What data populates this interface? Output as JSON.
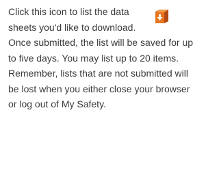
{
  "panel": {
    "icon": "download-list-icon",
    "text": "Click this icon to list the data sheets you'd like to download. Once submitted, the list will be saved for up to five days. You may list up to 20 items. Remember, lists that are not submitted will be lost when you either close your browser or log out of My Safety."
  },
  "colors": {
    "text": "#3a3a3a",
    "icon_orange": "#e8741e",
    "icon_dark_orange": "#c4561a",
    "background": "#ffffff"
  }
}
